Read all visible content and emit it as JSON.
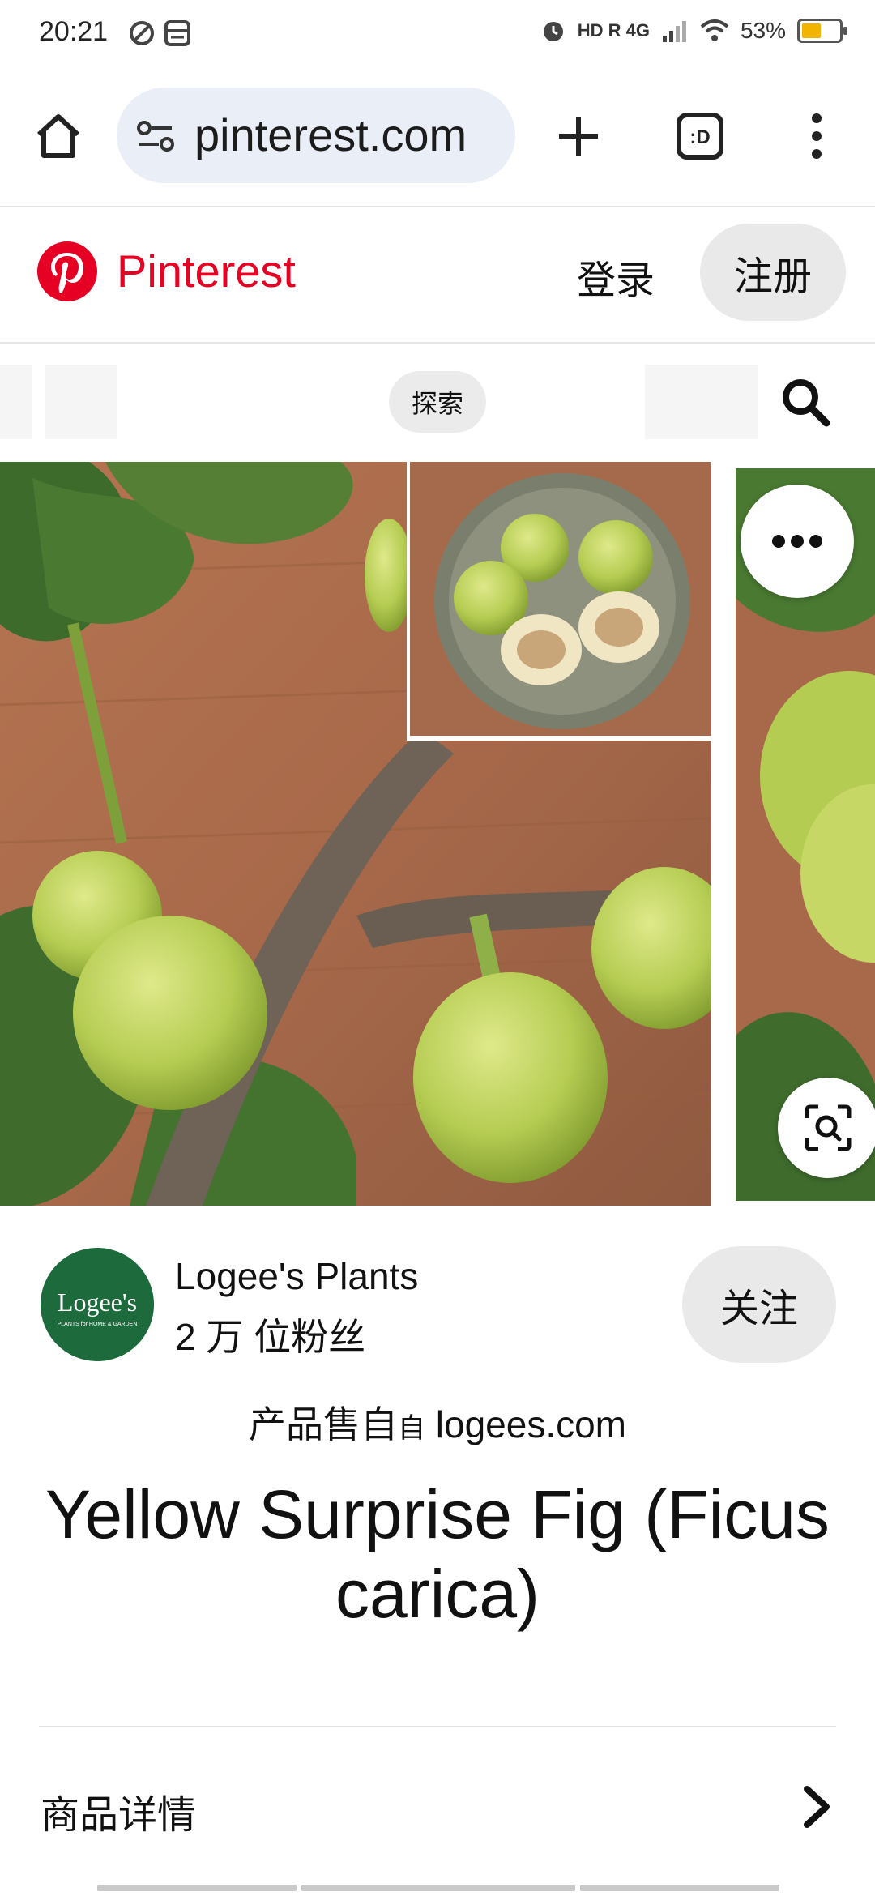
{
  "status_bar": {
    "time": "20:21",
    "network": "HD R 4G",
    "battery_percent": "53%",
    "battery_level": 0.53
  },
  "browser": {
    "url": "pinterest.com"
  },
  "header": {
    "brand": "Pinterest",
    "login": "登录",
    "signup": "注册"
  },
  "explore": {
    "label": "探索"
  },
  "creator": {
    "logo_text": "Logee's",
    "logo_subtext": "PLANTS for HOME & GARDEN",
    "name": "Logee's Plants",
    "followers": "2 万 位粉丝",
    "follow": "关注"
  },
  "sold_by": {
    "prefix": "产品售自",
    "zi": "自",
    "domain": "logees.com"
  },
  "pin": {
    "title": "Yellow Surprise Fig (Ficus carica)"
  },
  "details": {
    "label": "商品详情"
  },
  "colors": {
    "brand_red": "#e60023",
    "button_gray": "#e9e9e9"
  }
}
